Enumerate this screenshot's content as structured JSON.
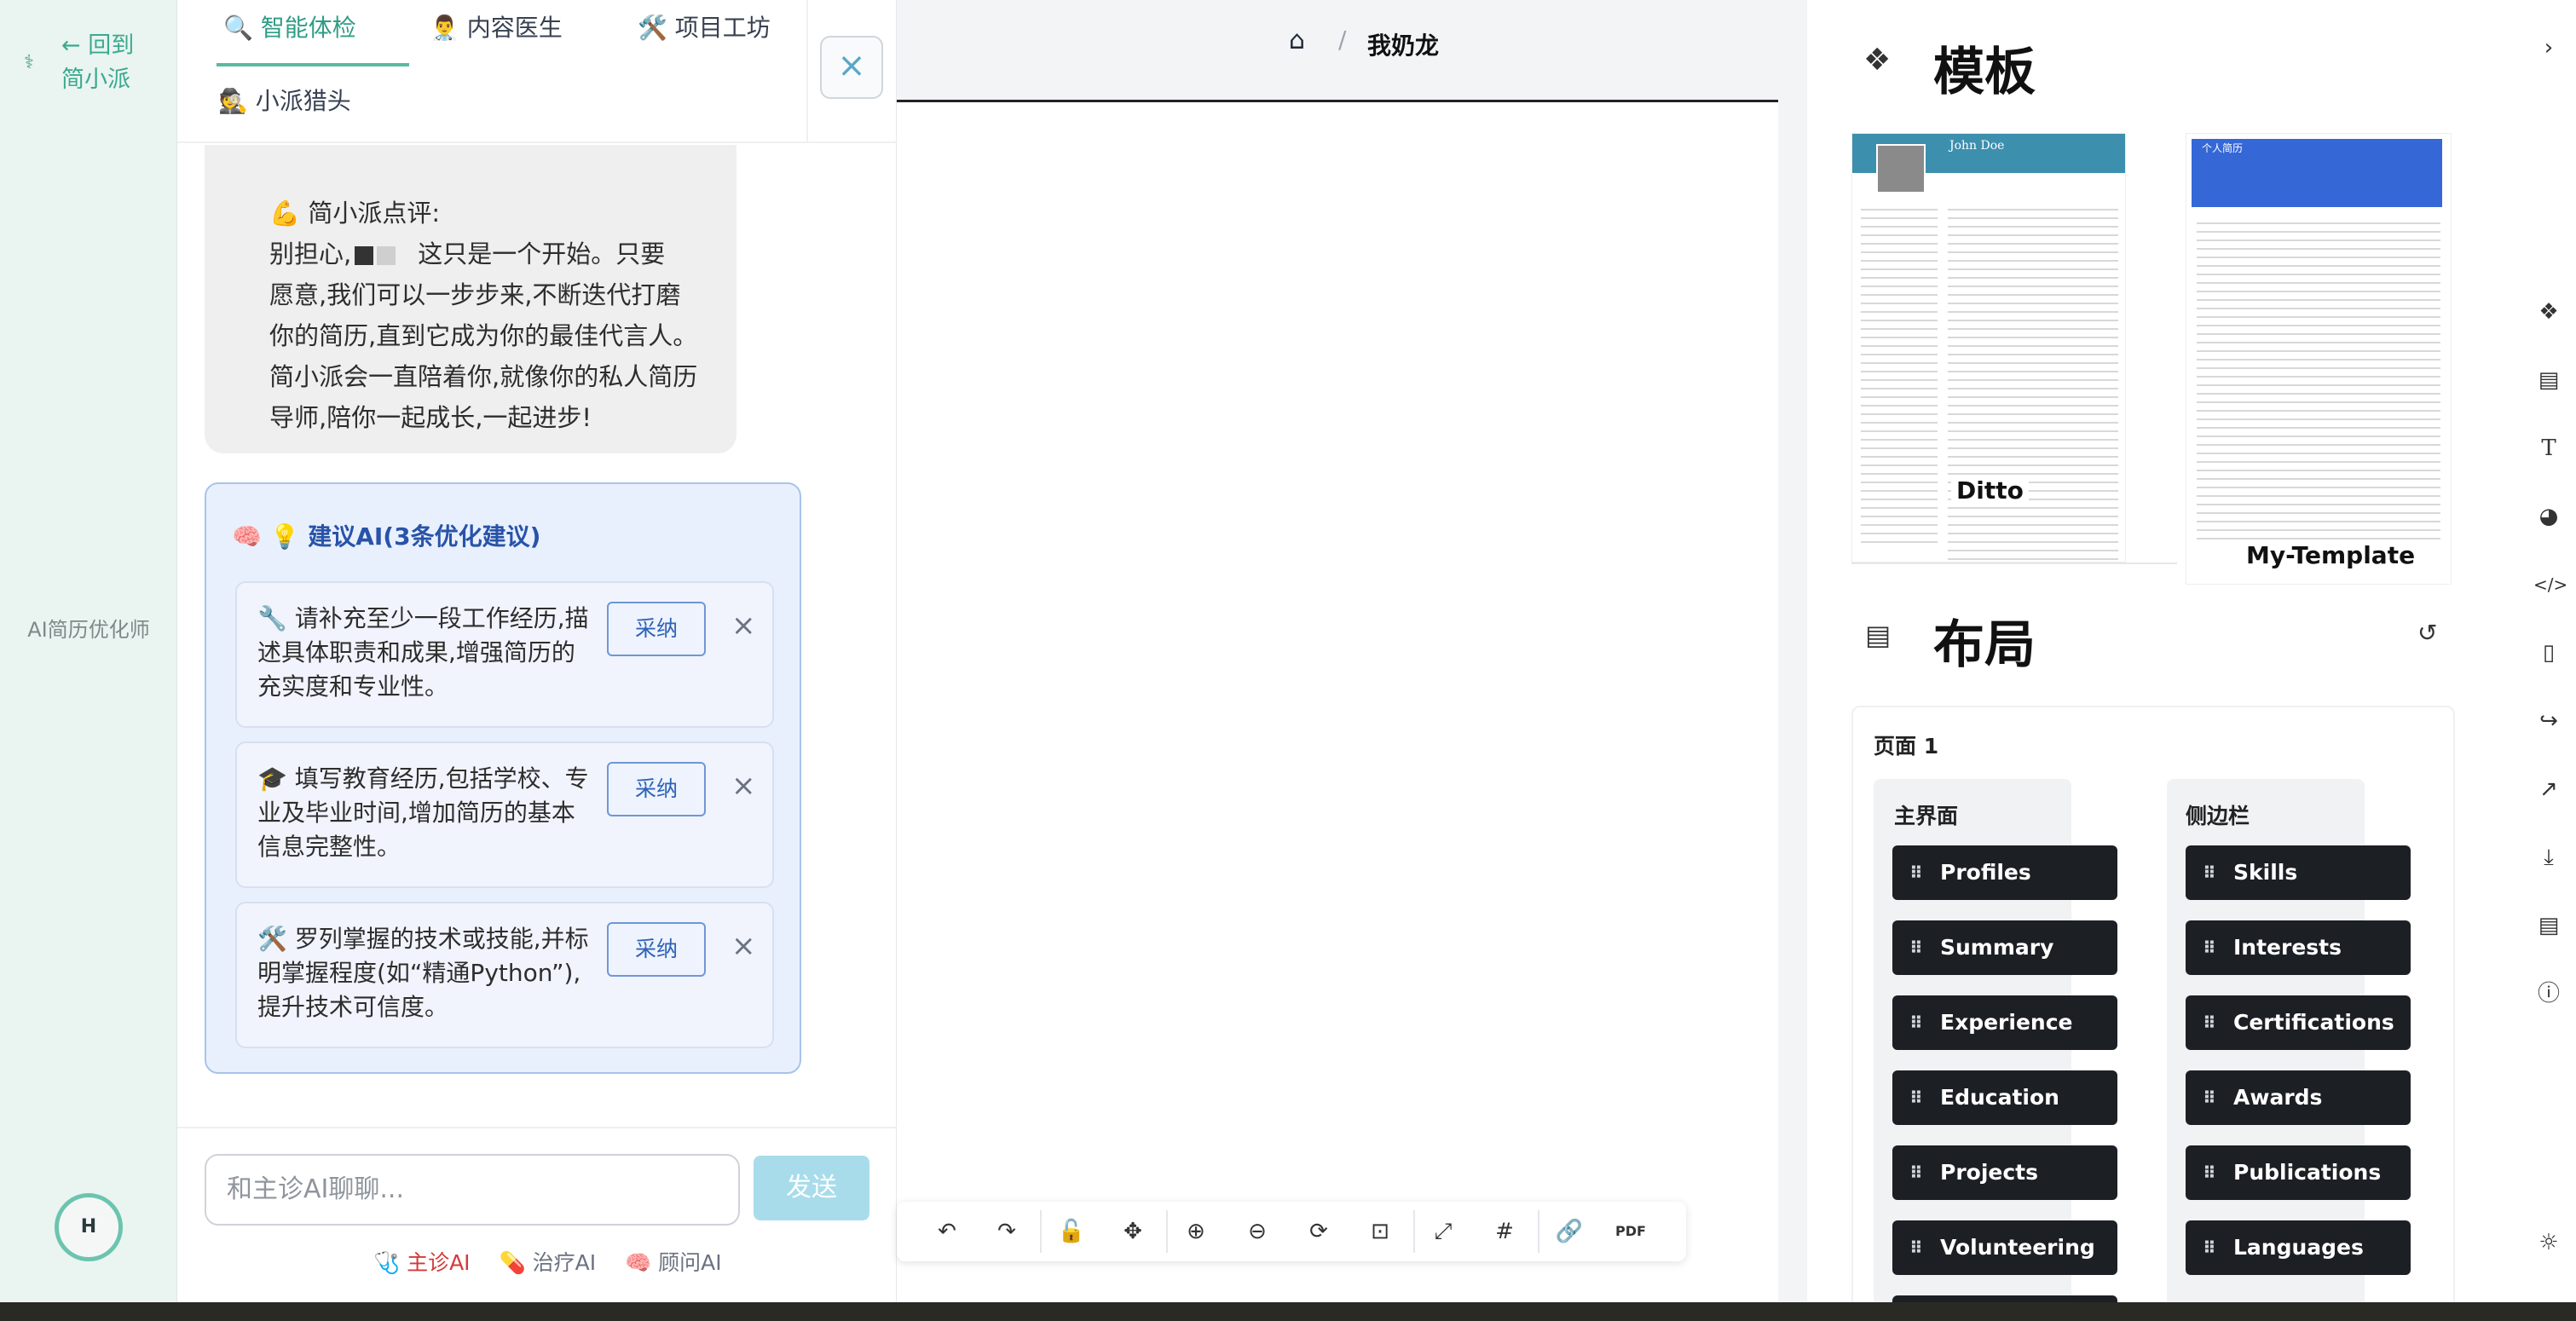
{
  "rail": {
    "back_label": "← 回到 简小派",
    "side_label": "AI简历优化师",
    "avatar_initial": "H"
  },
  "chat": {
    "tabs": [
      {
        "icon": "🔍",
        "label": "智能体检",
        "active": true
      },
      {
        "icon": "👨‍⚕️",
        "label": "内容医生",
        "active": false
      },
      {
        "icon": "🛠️",
        "label": "项目工坊",
        "active": false
      },
      {
        "icon": "🕵️",
        "label": "小派猎头",
        "active": false
      }
    ],
    "close_label": "×",
    "review": {
      "title": "💪 简小派点评:",
      "line1_prefix": "别担心,",
      "line1_suffix": "这只是一个开始。只要",
      "lines": [
        "愿意,我们可以一步步来,不断迭代打磨",
        "你的简历,直到它成为你的最佳代言人。",
        "简小派会一直陪着你,就像你的私人简历",
        "导师,陪你一起成长,一起进步!"
      ]
    },
    "suggestions": {
      "header": "🧠 💡 建议AI(3条优化建议)",
      "adopt_label": "采纳",
      "dismiss_label": "×",
      "items": [
        "🔧 请补充至少一段工作经历,描述具体职责和成果,增强简历的充实度和专业性。",
        "🎓 填写教育经历,包括学校、专业及毕业时间,增加简历的基本信息完整性。",
        "🛠️ 罗列掌握的技术或技能,并标明掌握程度(如“精通Python”),提升技术可信度。"
      ]
    },
    "input_placeholder": "和主诊AI聊聊...",
    "send_label": "发送",
    "modes": [
      {
        "label": "🩺 主诊AI",
        "active": true
      },
      {
        "label": "💊 治疗AI",
        "active": false
      },
      {
        "label": "🧠 顾问AI",
        "active": false
      }
    ]
  },
  "center": {
    "home_icon": "home-icon",
    "separator": "/",
    "resume_name": "我奶龙",
    "toolbar": [
      "undo-icon",
      "redo-icon",
      "lock-icon",
      "move-icon",
      "zoom-in-icon",
      "zoom-out-icon",
      "reset-zoom-icon",
      "fit-icon",
      "line-icon",
      "hash-icon",
      "link-icon",
      "pdf-icon"
    ]
  },
  "right": {
    "templates_title": "模板",
    "templates": [
      {
        "name": "Ditto",
        "header_name": "John Doe",
        "header_color": "#3d8fae"
      },
      {
        "name": "My-Template",
        "header_name": "个人简历",
        "header_color": "#3567d6"
      }
    ],
    "layout_title": "布局",
    "page_label": "页面 1",
    "main_label": "主界面",
    "sidebar_label": "侧边栏",
    "main_sections": [
      "Profiles",
      "Summary",
      "Experience",
      "Education",
      "Projects",
      "Volunteering"
    ],
    "sidebar_sections": [
      "Skills",
      "Interests",
      "Certifications",
      "Awards",
      "Publications",
      "Languages"
    ]
  },
  "iconbar": [
    "templates-icon",
    "layout-icon",
    "typography-icon",
    "theme-icon",
    "css-icon",
    "page-icon",
    "share-icon",
    "statistics-icon",
    "export-icon",
    "notes-icon",
    "info-icon",
    "sun-icon"
  ]
}
